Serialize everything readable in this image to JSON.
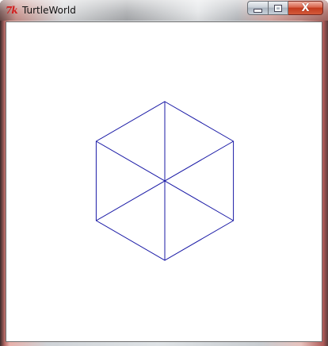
{
  "window": {
    "title": "TurtleWorld",
    "icon": "tk-feather-icon",
    "icon_text": "7k"
  },
  "controls": {
    "minimize_icon": "minimize-icon",
    "maximize_icon": "maximize-icon",
    "close_icon": "close-icon",
    "close_glyph": "X"
  },
  "canvas": {
    "background": "#ffffff",
    "stroke_color": "#1a1aa6",
    "shape": "hexagon with center spokes"
  }
}
